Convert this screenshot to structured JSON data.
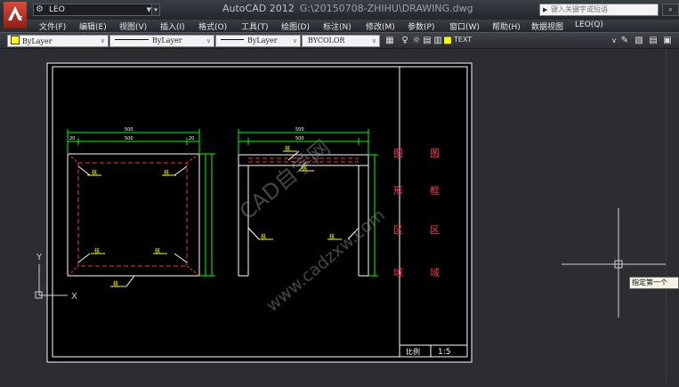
{
  "app": {
    "workspace": "LEO",
    "title": "AutoCAD 2012",
    "path": "G:\\20150708-ZHIHU\\DRAWING.dwg",
    "search_placeholder": "键入关键字或短语"
  },
  "menu": [
    "文件(F)",
    "编辑(E)",
    "视图(V)",
    "插入(I)",
    "格式(O)",
    "工具(T)",
    "绘图(D)",
    "标注(N)",
    "修改(M)",
    "参数(P)",
    "窗口(W)",
    "帮助(H)",
    "数据视图",
    "LEO(Q)"
  ],
  "properties": {
    "layer": "ByLayer",
    "linetype": "ByLayer",
    "lineweight": "ByLayer",
    "color": "BYCOLOR",
    "text_style": "TEXT"
  },
  "drawing": {
    "dims_total": "500",
    "dims_inner": "500",
    "dims_side": "20",
    "label_a": "核",
    "label_b": "核",
    "label_c": "核",
    "label_d": "核",
    "label_e": "核",
    "view2_a": "核",
    "view2_b": "核",
    "view2_c": "核",
    "view2_d": "核",
    "panel1": [
      "图",
      "形",
      "区",
      "域"
    ],
    "panel2": [
      "图",
      "框",
      "区",
      "域"
    ],
    "scale_label": "比例",
    "scale_value": "1:5",
    "watermark1": "CAD自学网",
    "watermark2": "www.cadzxw.com",
    "ucs_x": "X",
    "ucs_y": "Y"
  },
  "tooltip": "指定第一个",
  "colors": {
    "dim": "#00ff00",
    "outline": "#ffffff",
    "hidden": "#ff3333",
    "label_fill": "#ffff00",
    "panel_text": "#ff3355",
    "crosshair": "#cfcfcf"
  }
}
